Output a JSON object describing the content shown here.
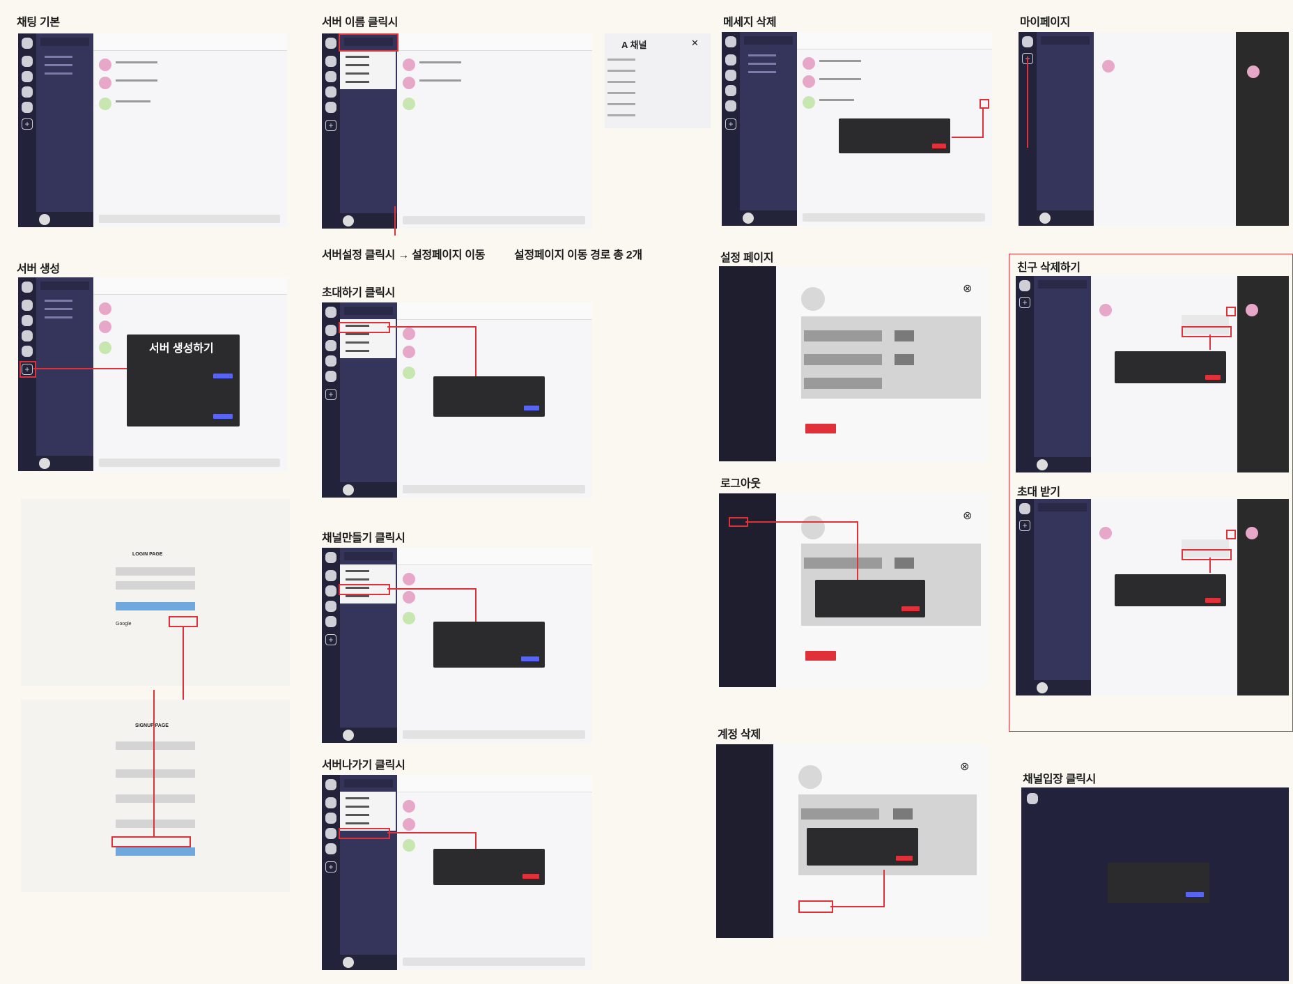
{
  "labels": {
    "chat_basic": "채팅 기본",
    "server_name_click": "서버 이름 클릭시",
    "message_delete": "메세지 삭제",
    "mypage": "마이페이지",
    "server_create": "서버 생성",
    "server_settings_click": "서버설정 클릭시 → 설정페이지 이동",
    "settings_paths": "설정페이지 이동 경로 총 2개",
    "settings_page": "설정 페이지",
    "friend_delete": "친구 삭제하기",
    "invite_click": "초대하기 클릭시",
    "logout": "로그아웃",
    "receive_invite": "초대 받기",
    "create_channel_click": "채널만들기 클릭시",
    "leave_server_click": "서버나가기 클릭시",
    "account_delete": "계정 삭제",
    "channel_enter_click": "채널입장 클릭시"
  },
  "texts": {
    "server_create_modal": "서버 생성하기",
    "a_channel": "A 채널",
    "a_channel_close": "✕",
    "login_page": "LOGIN PAGE",
    "signup_page": "SIGNUP PAGE",
    "google": "Google"
  },
  "colors": {
    "background": "#fbf8f1",
    "rail": "#22223a",
    "channel_list": "#35345a",
    "accent_red": "#e0303a",
    "accent_blue": "#5865f2",
    "modal_dark": "#2b2b2e"
  }
}
